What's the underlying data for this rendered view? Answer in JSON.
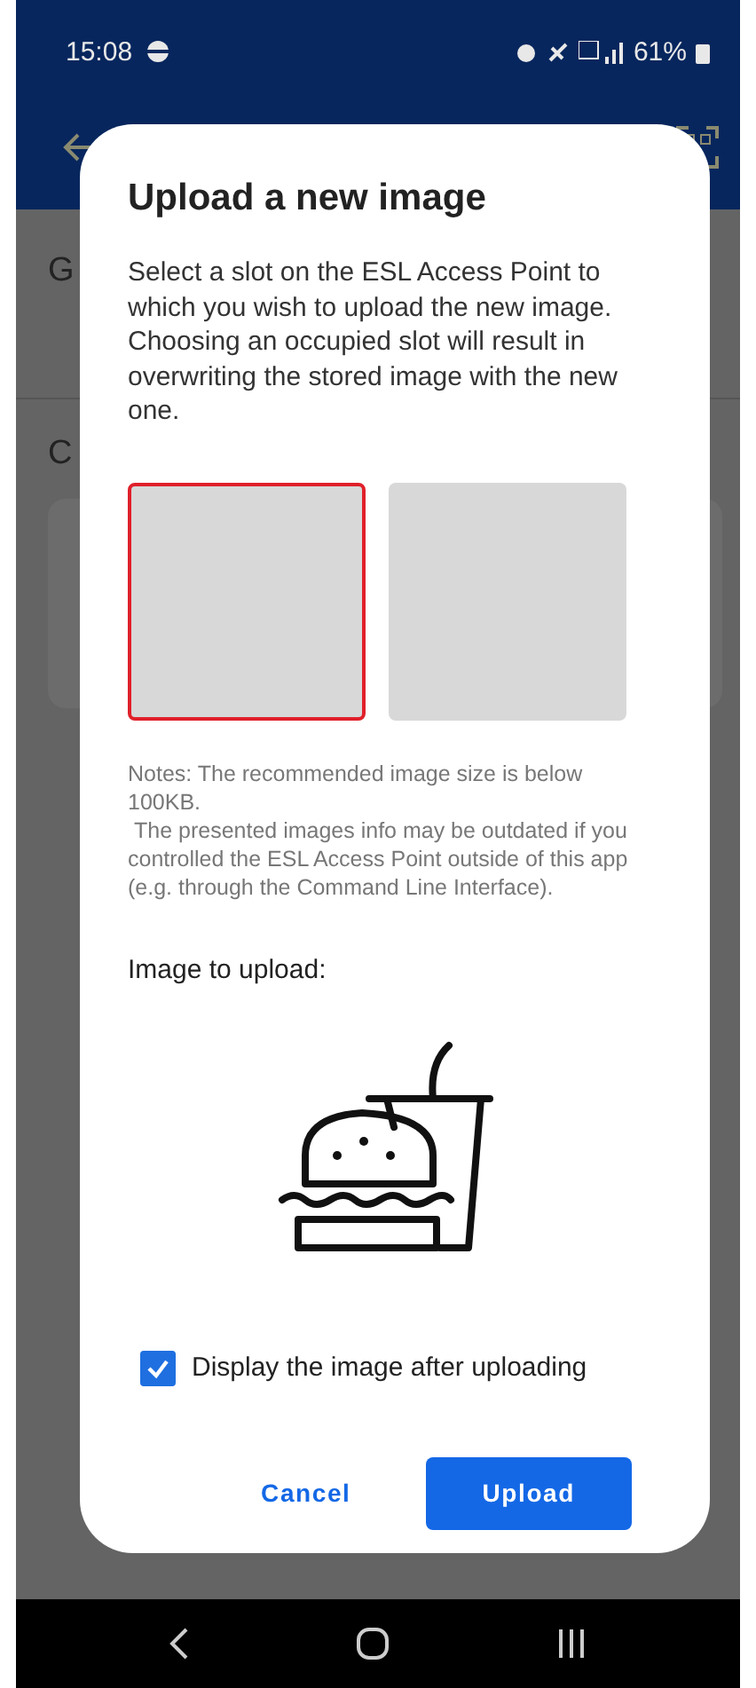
{
  "status_bar": {
    "time": "15:08",
    "battery": "61%"
  },
  "background": {
    "texts": [
      "G",
      "C"
    ]
  },
  "dialog": {
    "title": "Upload a new image",
    "description": "Select a slot on the ESL Access Point to which you wish to upload the new image. Choosing an occupied slot will result in overwriting the stored image with the new one.",
    "slots": [
      {
        "selected": true
      },
      {
        "selected": false
      }
    ],
    "notes": "Notes: The recommended image size is below 100KB.\n The presented images info may be outdated if you controlled the ESL Access Point outside of this app (e.g. through the Command Line Interface).",
    "image_label": "Image to upload:",
    "checkbox": {
      "label": "Display the image after uploading",
      "checked": true
    },
    "buttons": [
      {
        "label": "Cancel",
        "kind": "text"
      },
      {
        "label": "Upload",
        "kind": "filled"
      }
    ]
  }
}
